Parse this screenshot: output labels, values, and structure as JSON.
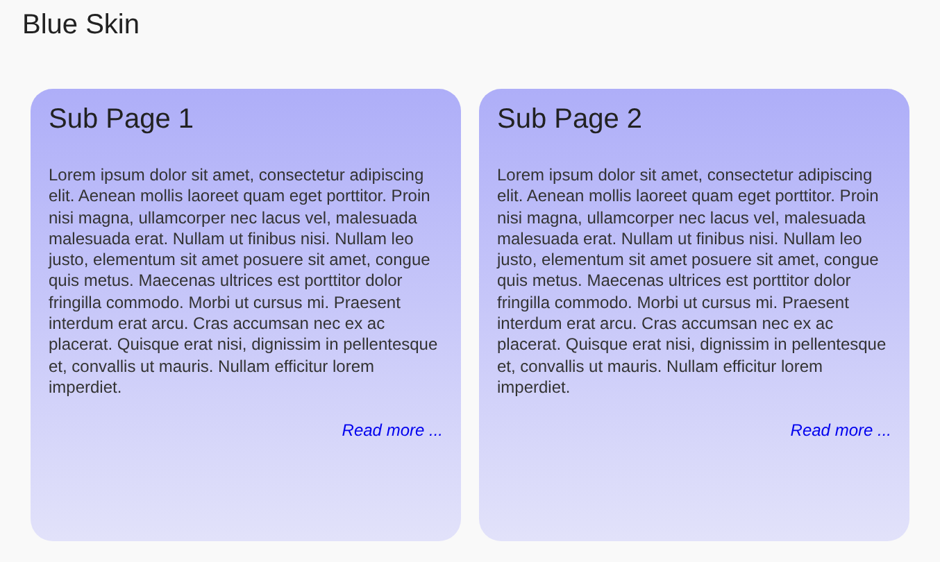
{
  "page": {
    "title": "Blue Skin"
  },
  "cards": [
    {
      "title": "Sub Page 1",
      "body": "Lorem ipsum dolor sit amet, consectetur adipiscing elit. Aenean mollis laoreet quam eget porttitor. Proin nisi magna, ullamcorper nec lacus vel, malesuada malesuada erat. Nullam ut finibus nisi. Nullam leo justo, elementum sit amet posuere sit amet, congue quis metus. Maecenas ultrices est porttitor dolor fringilla commodo. Morbi ut cursus mi. Praesent interdum erat arcu. Cras accumsan nec ex ac placerat. Quisque erat nisi, dignissim in pellentesque et, convallis ut mauris. Nullam efficitur lorem imperdiet.",
      "link": "Read more ..."
    },
    {
      "title": "Sub Page 2",
      "body": "Lorem ipsum dolor sit amet, consectetur adipiscing elit. Aenean mollis laoreet quam eget porttitor. Proin nisi magna, ullamcorper nec lacus vel, malesuada malesuada erat. Nullam ut finibus nisi. Nullam leo justo, elementum sit amet posuere sit amet, congue quis metus. Maecenas ultrices est porttitor dolor fringilla commodo. Morbi ut cursus mi. Praesent interdum erat arcu. Cras accumsan nec ex ac placerat. Quisque erat nisi, dignissim in pellentesque et, convallis ut mauris. Nullam efficitur lorem imperdiet.",
      "link": "Read more ..."
    }
  ]
}
